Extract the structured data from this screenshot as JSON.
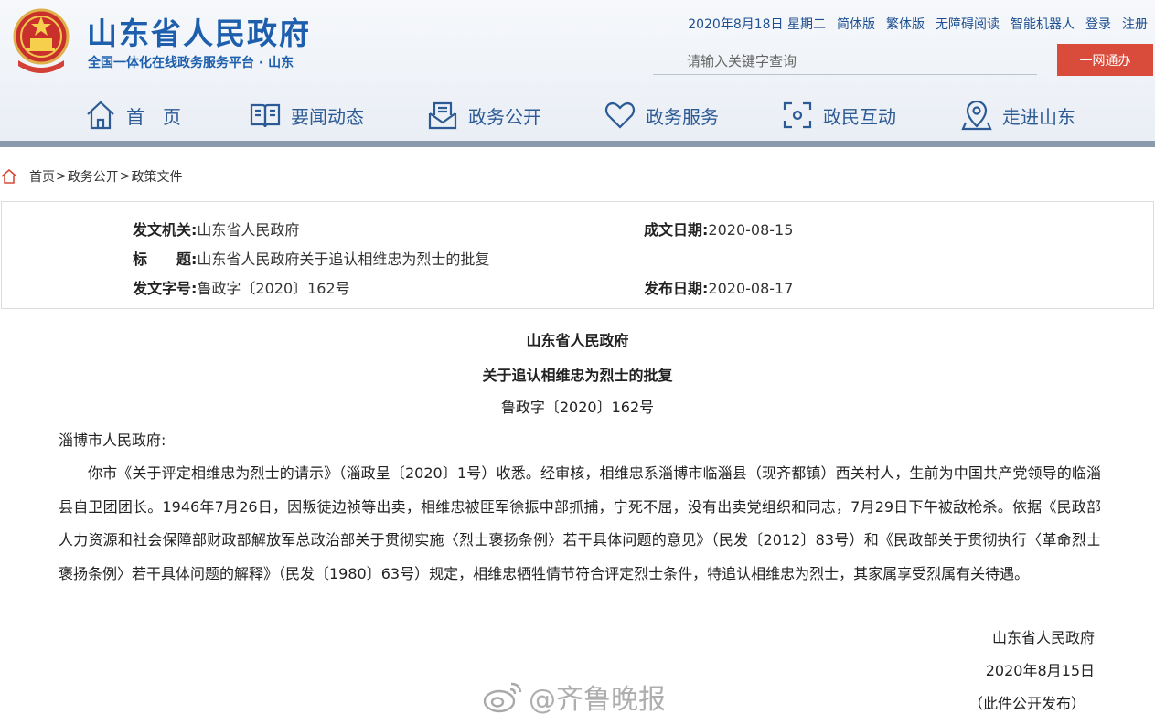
{
  "header": {
    "site_title": "山东省人民政府",
    "site_subtitle": "全国一体化在线政务服务平台 · 山东",
    "date_text": "2020年8月18日 星期二",
    "links": [
      "简体版",
      "繁体版",
      "无障碍阅读",
      "智能机器人",
      "登录",
      "注册"
    ],
    "search_placeholder": "请输入关键字查询",
    "search_button": "一网通办"
  },
  "nav": {
    "items": [
      {
        "label": "首　页",
        "icon": "home-icon"
      },
      {
        "label": "要闻动态",
        "icon": "book-icon"
      },
      {
        "label": "政务公开",
        "icon": "inbox-icon"
      },
      {
        "label": "政务服务",
        "icon": "heart-icon"
      },
      {
        "label": "政民互动",
        "icon": "interaction-icon"
      },
      {
        "label": "走进山东",
        "icon": "location-icon"
      }
    ]
  },
  "breadcrumb": [
    "首页",
    "政务公开",
    "政策文件"
  ],
  "meta": {
    "issuer_label": "发文机关:",
    "issuer": "山东省人民政府",
    "written_label": "成文日期:",
    "written_date": "2020-08-15",
    "title_label": "标　　题:",
    "title": "山东省人民政府关于追认相维忠为烈士的批复",
    "doc_no_label": "发文字号:",
    "doc_no": "鲁政字〔2020〕162号",
    "published_label": "发布日期:",
    "published_date": "2020-08-17"
  },
  "document": {
    "org": "山东省人民政府",
    "title": "关于追认相维忠为烈士的批复",
    "doc_no": "鲁政字〔2020〕162号",
    "addressee": "淄博市人民政府:",
    "body": "你市《关于评定相维忠为烈士的请示》（淄政呈〔2020〕1号）收悉。经审核，相维忠系淄博市临淄县（现齐都镇）西关村人，生前为中国共产党领导的临淄县自卫团团长。1946年7月26日，因叛徒边祯等出卖，相维忠被匪军徐振中部抓捕，宁死不屈，没有出卖党组织和同志，7月29日下午被敌枪杀。依据《民政部人力资源和社会保障部财政部解放军总政治部关于贯彻实施〈烈士褒扬条例〉若干具体问题的意见》（民发〔2012〕83号）和《民政部关于贯彻执行〈革命烈士褒扬条例〉若干具体问题的解释》（民发〔1980〕63号）规定，相维忠牺牲情节符合评定烈士条件，特追认相维忠为烈士，其家属享受烈属有关待遇。",
    "signature": "山东省人民政府",
    "sign_date": "2020年8月15日",
    "note": "（此件公开发布）"
  },
  "watermark": "@齐鲁晚报",
  "colors": {
    "brand_blue": "#1d5fad",
    "nav_text": "#2c5a94",
    "button_red": "#d94b3b",
    "nav_bar": "#8b99ad"
  }
}
